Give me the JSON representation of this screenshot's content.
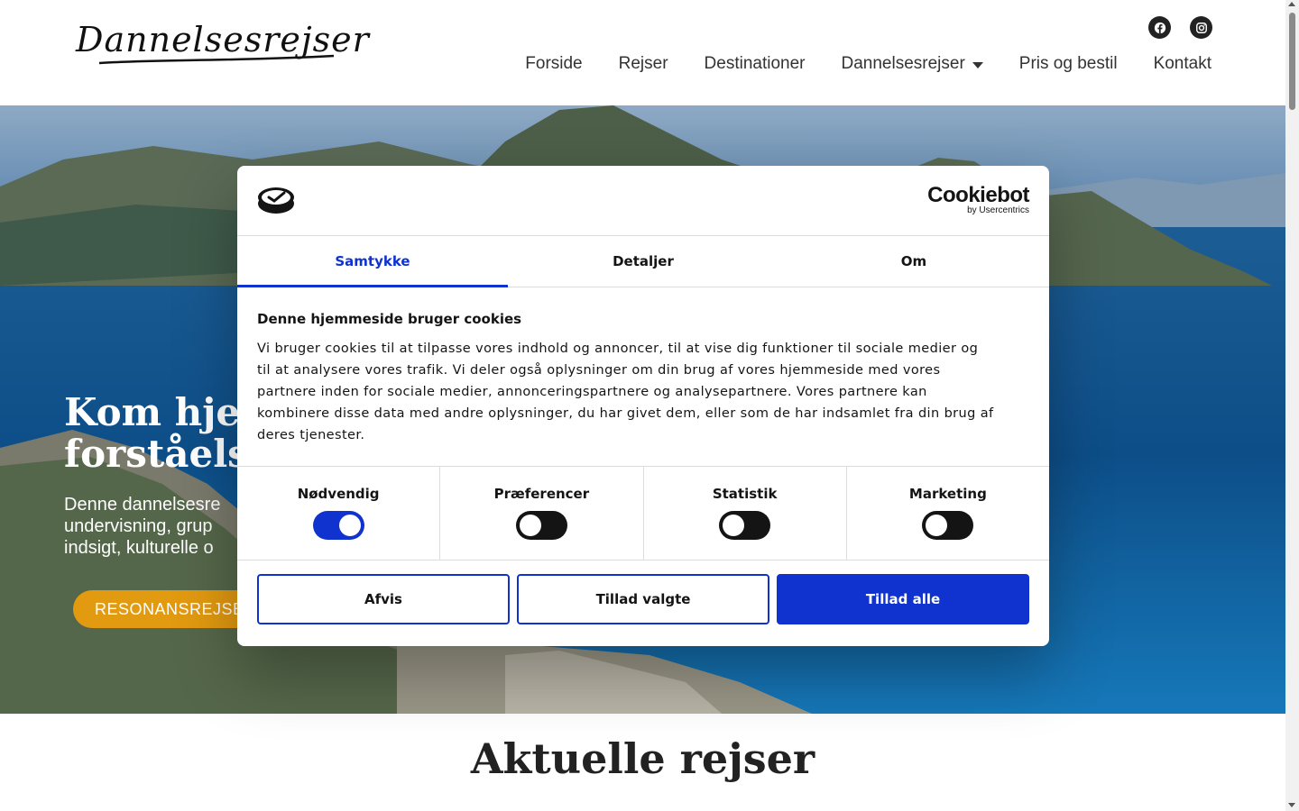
{
  "header": {
    "logo_text": "Dannelsesrejser",
    "social_icons": [
      "facebook-icon",
      "instagram-icon"
    ],
    "nav": [
      {
        "label": "Forside"
      },
      {
        "label": "Rejser"
      },
      {
        "label": "Destinationer"
      },
      {
        "label": "Dannelsesrejser",
        "has_dropdown": true
      },
      {
        "label": "Pris og bestil"
      },
      {
        "label": "Kontakt"
      }
    ]
  },
  "hero": {
    "title_line1": "Kom hjem",
    "title_line2": "forståelse",
    "text_line1": "Denne dannelsesre",
    "text_line2": "undervisning, grup",
    "text_line3": "indsigt, kulturelle o",
    "button_label": "RESONANSREJSE"
  },
  "section": {
    "title": "Aktuelle rejser"
  },
  "cookie_dialog": {
    "brand": "Cookiebot",
    "brand_sub": "by Usercentrics",
    "tabs": [
      {
        "label": "Samtykke",
        "active": true
      },
      {
        "label": "Detaljer",
        "active": false
      },
      {
        "label": "Om",
        "active": false
      }
    ],
    "heading": "Denne hjemmeside bruger cookies",
    "body_lines": [
      "Vi bruger cookies til at tilpasse vores indhold og annoncer, til at vise dig funktioner til sociale medier og",
      "til at analysere vores trafik. Vi deler også oplysninger om din brug af vores hjemmeside med vores",
      "partnere inden for sociale medier, annonceringspartnere og analysepartnere. Vores partnere kan",
      "kombinere disse data med andre oplysninger, du har givet dem, eller som de har indsamlet fra din brug af",
      "deres tjenester."
    ],
    "toggles": [
      {
        "label": "Nødvendig",
        "on": true
      },
      {
        "label": "Præferencer",
        "on": false
      },
      {
        "label": "Statistik",
        "on": false
      },
      {
        "label": "Marketing",
        "on": false
      }
    ],
    "buttons": {
      "decline": "Afvis",
      "allow_selected": "Tillad valgte",
      "allow_all": "Tillad alle"
    },
    "accent_color": "#1032cf"
  }
}
